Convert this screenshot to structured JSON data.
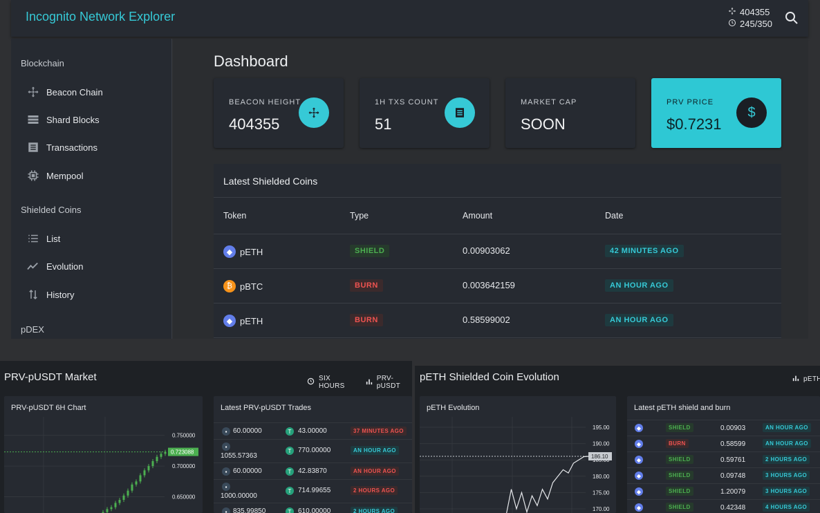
{
  "app_title": "Incognito Network Explorer",
  "topbar": {
    "beacon_height": "404355",
    "progress": "245/350"
  },
  "sidebar": {
    "sections": [
      "Blockchain",
      "Shielded Coins",
      "pDEX"
    ],
    "items": [
      {
        "label": "Beacon Chain",
        "icon": "move-icon"
      },
      {
        "label": "Shard Blocks",
        "icon": "list-bars-icon"
      },
      {
        "label": "Transactions",
        "icon": "receipt-icon"
      },
      {
        "label": "Mempool",
        "icon": "chip-icon"
      },
      {
        "label": "List",
        "icon": "list-icon"
      },
      {
        "label": "Evolution",
        "icon": "trend-icon"
      },
      {
        "label": "History",
        "icon": "swap-vertical-icon"
      }
    ]
  },
  "dashboard": {
    "title": "Dashboard",
    "cards": [
      {
        "label": "BEACON HEIGHT",
        "value": "404355",
        "icon": "move-icon"
      },
      {
        "label": "1H TXS COUNT",
        "value": "51",
        "icon": "receipt-icon"
      },
      {
        "label": "MARKET CAP",
        "value": "SOON"
      },
      {
        "label": "PRV PRICE",
        "value": "$0.7231",
        "icon": "dollar-icon"
      }
    ]
  },
  "shielded": {
    "title": "Latest Shielded Coins",
    "headers": [
      "Token",
      "Type",
      "Amount",
      "Date"
    ],
    "rows": [
      {
        "token": "pETH",
        "type": "SHIELD",
        "amount": "0.00903062",
        "date": "42 MINUTES AGO"
      },
      {
        "token": "pBTC",
        "type": "BURN",
        "amount": "0.003642159",
        "date": "AN HOUR AGO"
      },
      {
        "token": "pETH",
        "type": "BURN",
        "amount": "0.58599002",
        "date": "AN HOUR AGO"
      }
    ]
  },
  "market": {
    "title": "PRV-pUSDT Market",
    "range": "SIX HOURS",
    "pair": "PRV-pUSDT",
    "chart_title": "PRV-pUSDT 6H Chart",
    "trades_title": "Latest PRV-pUSDT Trades",
    "trades": [
      {
        "a": "60.00000",
        "b": "43.00000",
        "t": "37 MINUTES AGO",
        "c": "red"
      },
      {
        "a": "1055.57363",
        "b": "770.00000",
        "t": "AN HOUR AGO",
        "c": "teal"
      },
      {
        "a": "60.00000",
        "b": "42.83870",
        "t": "AN HOUR AGO",
        "c": "red"
      },
      {
        "a": "1000.00000",
        "b": "714.99655",
        "t": "2 HOURS AGO",
        "c": "red"
      },
      {
        "a": "835.99850",
        "b": "610.00000",
        "t": "2 HOURS AGO",
        "c": "teal"
      }
    ]
  },
  "evolution": {
    "title": "pETH Shielded Coin Evolution",
    "right_label": "pETH",
    "chart_title": "pETH Evolution",
    "list_title": "Latest pETH shield and burn",
    "rows": [
      {
        "type": "SHIELD",
        "amount": "0.00903",
        "t": "AN HOUR AGO"
      },
      {
        "type": "BURN",
        "amount": "0.58599",
        "t": "AN HOUR AGO"
      },
      {
        "type": "SHIELD",
        "amount": "0.59761",
        "t": "2 HOURS AGO"
      },
      {
        "type": "SHIELD",
        "amount": "0.09748",
        "t": "3 HOURS AGO"
      },
      {
        "type": "SHIELD",
        "amount": "1.20079",
        "t": "3 HOURS AGO"
      },
      {
        "type": "SHIELD",
        "amount": "0.42348",
        "t": "4 HOURS AGO"
      }
    ]
  },
  "chart_data": [
    {
      "type": "candlestick",
      "title": "PRV-pUSDT 6H Chart",
      "y_ticks": [
        "0.750000",
        "0.700000",
        "0.650000"
      ],
      "current": "0.723088",
      "values": [
        0.62,
        0.625,
        0.63,
        0.633,
        0.64,
        0.645,
        0.652,
        0.66,
        0.67,
        0.675,
        0.685,
        0.693,
        0.7,
        0.708,
        0.715,
        0.72,
        0.723
      ]
    },
    {
      "type": "line",
      "title": "pETH Evolution",
      "y_ticks": [
        "195.00",
        "190.00",
        "185.00",
        "180.00",
        "175.00",
        "170.00"
      ],
      "current": "186.10",
      "values": [
        168,
        176,
        170,
        175,
        169,
        174,
        171,
        176,
        173,
        178,
        180,
        182,
        181,
        184,
        185,
        186,
        186.1
      ]
    }
  ],
  "colors": {
    "accent": "#36c9d6",
    "shield": "#4caf50",
    "burn": "#ef5350",
    "card_bg": "#262a31"
  }
}
